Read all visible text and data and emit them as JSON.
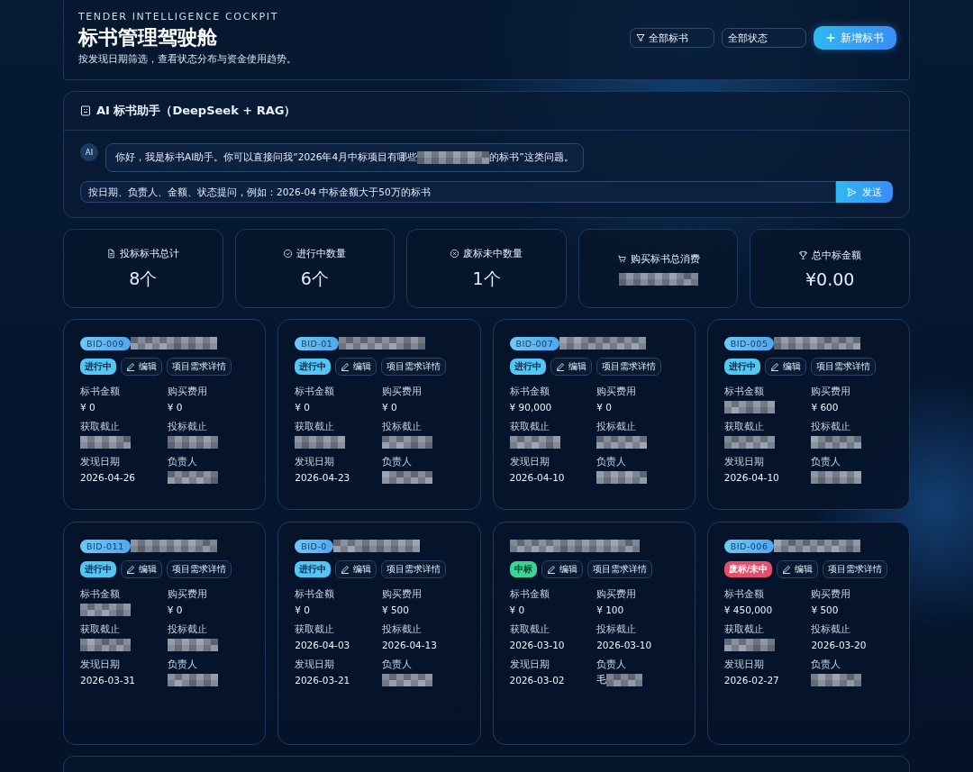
{
  "header": {
    "eyebrow": "TENDER INTELLIGENCE COCKPIT",
    "title": "标书管理驾驶舱",
    "subtitle": "按发现日期筛选，查看状态分布与资金使用趋势。",
    "filters": [
      {
        "kind": "filter",
        "label": "全部标书"
      },
      {
        "kind": "plain",
        "label": "全部状态"
      }
    ],
    "add_button": "新增标书"
  },
  "assistant": {
    "title": "AI 标书助手（DeepSeek + RAG）",
    "avatar": "AI",
    "message_start": "你好，我是标书AI助手。你可以直接问我“2026年4月中标项目有哪些",
    "message_redacted": true,
    "message_end": "的标书”这类问题。",
    "input_placeholder": "按日期、负责人、金额、状态提问，例如：2026-04 中标金额大于50万的标书",
    "send": "发送"
  },
  "stats": [
    {
      "kind": "doc",
      "label": "投标标书总计",
      "value": "8个"
    },
    {
      "kind": "check",
      "label": "进行中数量",
      "value": "6个"
    },
    {
      "kind": "cross",
      "label": "废标未中数量",
      "value": "1个"
    },
    {
      "kind": "cart",
      "label": "购买标书总消费",
      "redacted": true
    },
    {
      "kind": "trophy",
      "label": "总中标金额",
      "value": "¥0.00"
    }
  ],
  "cards": [
    {
      "bid": "BID-009",
      "status": {
        "kind": "ongoing",
        "label": "进行中"
      },
      "edit": "编辑",
      "details": "项目需求详情",
      "fields": [
        {
          "label": "标书金额",
          "value": "¥ 0"
        },
        {
          "label": "购买费用",
          "value": "¥ 0"
        },
        {
          "label": "获取截止",
          "redacted": true
        },
        {
          "label": "投标截止",
          "redacted": true
        },
        {
          "label": "发现日期",
          "value": "2026-04-26"
        },
        {
          "label": "负责人",
          "redacted": true
        }
      ]
    },
    {
      "bid": "BID-01",
      "status": {
        "kind": "ongoing",
        "label": "进行中"
      },
      "edit": "编辑",
      "details": "项目需求详情",
      "fields": [
        {
          "label": "标书金额",
          "value": "¥ 0"
        },
        {
          "label": "购买费用",
          "value": "¥ 0"
        },
        {
          "label": "获取截止",
          "redacted": true
        },
        {
          "label": "投标截止",
          "redacted": true
        },
        {
          "label": "发现日期",
          "value": "2026-04-23"
        },
        {
          "label": "负责人",
          "redacted": true
        }
      ]
    },
    {
      "bid": "BID-007",
      "status": {
        "kind": "ongoing",
        "label": "进行中"
      },
      "edit": "编辑",
      "details": "项目需求详情",
      "fields": [
        {
          "label": "标书金额",
          "value": "¥ 90,000"
        },
        {
          "label": "购买费用",
          "value": "¥ 0"
        },
        {
          "label": "获取截止",
          "redacted": true
        },
        {
          "label": "投标截止",
          "redacted": true
        },
        {
          "label": "发现日期",
          "value": "2026-04-10"
        },
        {
          "label": "负责人",
          "redacted": true
        }
      ]
    },
    {
      "bid": "BID-005",
      "status": {
        "kind": "ongoing",
        "label": "进行中"
      },
      "edit": "编辑",
      "details": "项目需求详情",
      "fields": [
        {
          "label": "标书金额",
          "redacted": true
        },
        {
          "label": "购买费用",
          "value": "¥ 600"
        },
        {
          "label": "获取截止",
          "redacted": true
        },
        {
          "label": "投标截止",
          "redacted": true
        },
        {
          "label": "发现日期",
          "value": "2026-04-10"
        },
        {
          "label": "负责人",
          "redacted": true
        }
      ]
    },
    {
      "bid": "BID-011",
      "status": {
        "kind": "ongoing",
        "label": "进行中"
      },
      "edit": "编辑",
      "details": "项目需求详情",
      "fields": [
        {
          "label": "标书金额",
          "redacted": true
        },
        {
          "label": "购买费用",
          "value": "¥ 0"
        },
        {
          "label": "获取截止",
          "redacted": true
        },
        {
          "label": "投标截止",
          "redacted": true
        },
        {
          "label": "发现日期",
          "value": "2026-03-31"
        },
        {
          "label": "负责人",
          "redacted": true
        }
      ]
    },
    {
      "bid": "BID-0",
      "status": {
        "kind": "ongoing",
        "label": "进行中"
      },
      "edit": "编辑",
      "details": "项目需求详情",
      "fields": [
        {
          "label": "标书金额",
          "value": "¥ 0"
        },
        {
          "label": "购买费用",
          "value": "¥ 500"
        },
        {
          "label": "获取截止",
          "value": "2026-04-03"
        },
        {
          "label": "投标截止",
          "value": "2026-04-13"
        },
        {
          "label": "发现日期",
          "value": "2026-03-21"
        },
        {
          "label": "负责人",
          "redacted": true
        }
      ]
    },
    {
      "status": {
        "kind": "won",
        "label": "中标"
      },
      "edit": "编辑",
      "details": "项目需求详情",
      "fields": [
        {
          "label": "标书金额",
          "value": "¥ 0"
        },
        {
          "label": "购买费用",
          "value": "¥ 100"
        },
        {
          "label": "获取截止",
          "value": "2026-03-10"
        },
        {
          "label": "投标截止",
          "value": "2026-03-10"
        },
        {
          "label": "发现日期",
          "value": "2026-03-02"
        },
        {
          "label": "负责人",
          "value": "毛",
          "redacted": true
        }
      ]
    },
    {
      "bid": "BID-006",
      "status": {
        "kind": "lost",
        "label": "废标/未中"
      },
      "edit": "编辑",
      "details": "项目需求详情",
      "fields": [
        {
          "label": "标书金额",
          "value": "¥ 450,000"
        },
        {
          "label": "购买费用",
          "value": "¥ 500"
        },
        {
          "label": "获取截止",
          "redacted": true
        },
        {
          "label": "投标截止",
          "value": "2026-03-20"
        },
        {
          "label": "发现日期",
          "value": "2026-02-27"
        },
        {
          "label": "负责人",
          "redacted": true
        }
      ]
    }
  ]
}
